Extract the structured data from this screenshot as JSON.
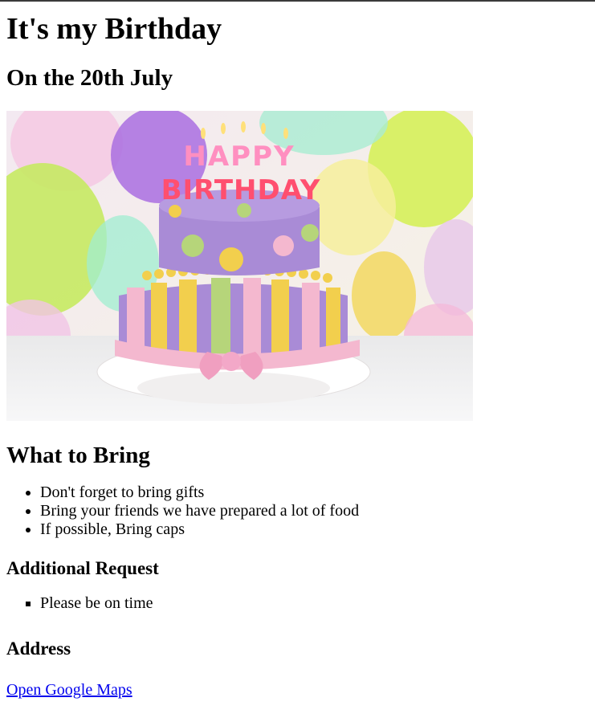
{
  "page": {
    "title": "It's my Birthday",
    "subtitle": "On the 20th July",
    "image": {
      "alt": "Birthday cake with Happy Birthday candles and balloons",
      "banner_text": "HAPPY BIRTHDAY"
    },
    "bring": {
      "heading": "What to Bring",
      "items": [
        "Don't forget to bring gifts",
        "Bring your friends we have prepared a lot of food",
        "If possible, Bring caps"
      ]
    },
    "request": {
      "heading": "Additional Request",
      "items": [
        "Please be on time"
      ]
    },
    "address": {
      "heading": "Address",
      "link_label": "Open Google Maps"
    },
    "colors": {
      "link": "#0000ee",
      "cake_purple": "#a98bd6",
      "ribbon_pink": "#f4b8cf",
      "accent_yellow": "#f2cf4d",
      "accent_green": "#b6d57a"
    }
  }
}
